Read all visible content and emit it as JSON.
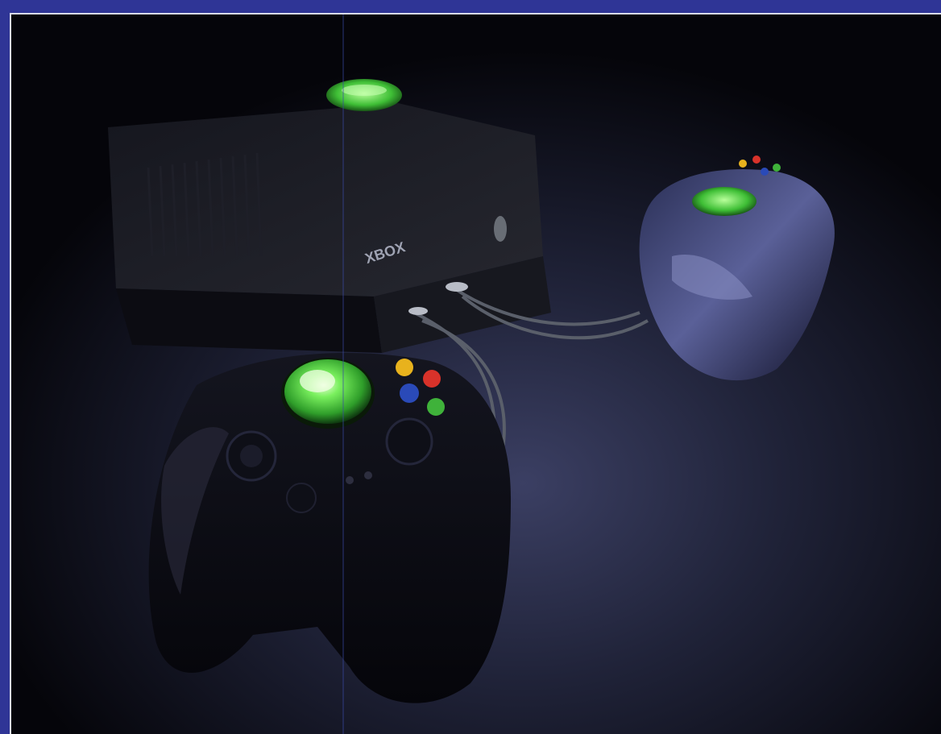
{
  "photo": {
    "subject_labels": {
      "console_logo": "XBOX"
    },
    "colors": {
      "frame_border": "#2f3596",
      "inner_border": "#d9dbe8",
      "background": "#07070d",
      "floor_highlight": "#3a3f66",
      "jewel_green": "#58d84a",
      "button_yellow": "#e8b21d",
      "button_red": "#d8322a",
      "button_blue": "#2a4ab8",
      "button_green": "#3fb23a"
    },
    "icons": {
      "console": "xbox-console-icon",
      "controller_front": "xbox-controller-icon",
      "controller_back": "xbox-controller-icon"
    }
  }
}
